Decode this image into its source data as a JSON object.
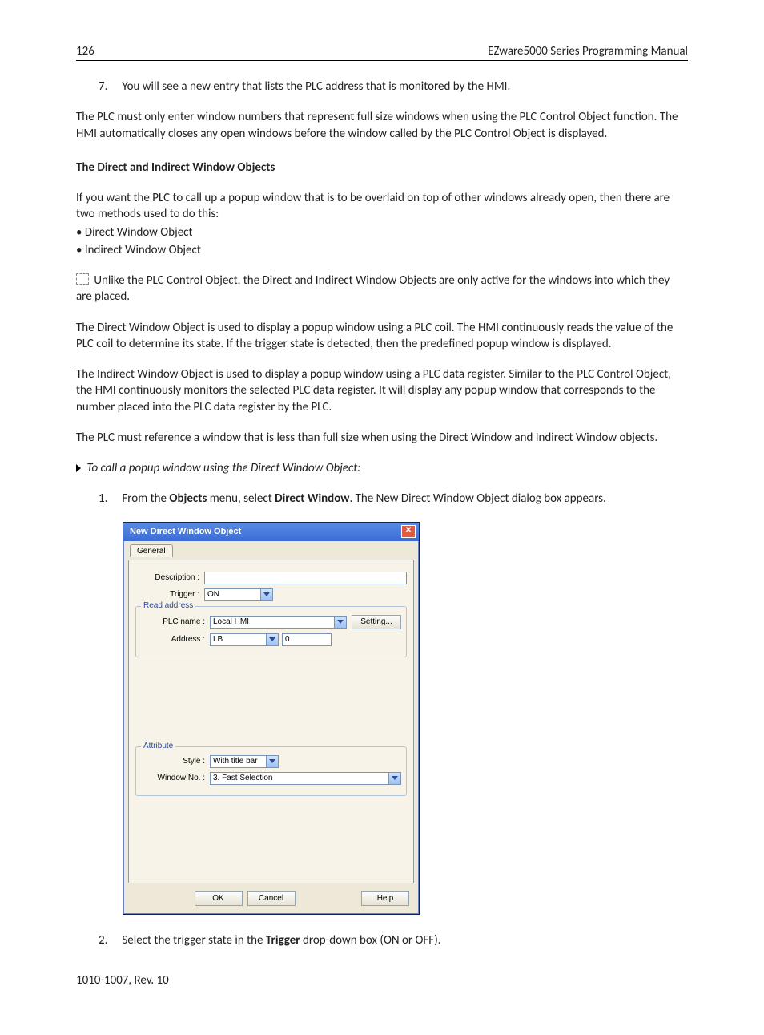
{
  "header": {
    "page_number": "126",
    "manual_title": "EZware5000 Series Programming Manual"
  },
  "list7": {
    "num": "7.",
    "text": "You will see a new entry that lists the PLC address that is monitored by the HMI."
  },
  "para_plc_must": "The PLC must only enter window numbers that represent full size windows when using the PLC Control Object function. The HMI automatically closes any open windows before the window called by the PLC Control Object is displayed.",
  "subhead_direct_indirect": "The Direct and Indirect Window Objects",
  "para_if_you_want": "If you want the PLC to call up a popup window that is to be overlaid on top of other windows already open, then there are two methods used to do this:",
  "bullet1": "•  Direct Window Object",
  "bullet2": "•  Indirect Window Object",
  "para_unlike": " Unlike the PLC Control Object, the Direct and Indirect Window Objects are only active for the windows into which they are placed.",
  "para_direct_window": "The Direct Window Object is used to display a popup window using a PLC coil. The HMI continuously reads the value of the PLC coil to determine its state. If the trigger state is detected, then the predefined popup window is displayed.",
  "para_indirect_window": "The Indirect Window Object is used to display a popup window using a PLC data register. Similar to the PLC Control Object, the HMI continuously monitors the selected PLC data register. It will display any popup window that corresponds to the number placed into the PLC data register by the PLC.",
  "para_plc_reference": "The PLC must reference a window that is less than full size when using the Direct Window and Indirect Window objects.",
  "callout": "To call a popup window using the Direct Window Object:",
  "step1": {
    "num": "1.",
    "pre": "From the ",
    "b1": "Objects",
    "mid": " menu, select ",
    "b2": "Direct Window",
    "post": ". The New Direct Window Object dialog box appears."
  },
  "dialog": {
    "title": "New  Direct Window Object",
    "tab": "General",
    "labels": {
      "description": "Description :",
      "trigger": "Trigger :",
      "read_address": "Read address",
      "plc_name": "PLC name :",
      "address": "Address :",
      "attribute": "Attribute",
      "style": "Style :",
      "window_no": "Window No. :"
    },
    "values": {
      "trigger": "ON",
      "plc_name": "Local HMI",
      "setting": "Setting...",
      "address_type": "LB",
      "address_value": "0",
      "style": "With title bar",
      "window_no": "3. Fast Selection"
    },
    "buttons": {
      "ok": "OK",
      "cancel": "Cancel",
      "help": "Help"
    }
  },
  "step2": {
    "num": "2.",
    "pre": "Select the trigger state in the ",
    "b1": "Trigger",
    "post": " drop-down box (ON or OFF)."
  },
  "footer": "1010-1007, Rev. 10"
}
